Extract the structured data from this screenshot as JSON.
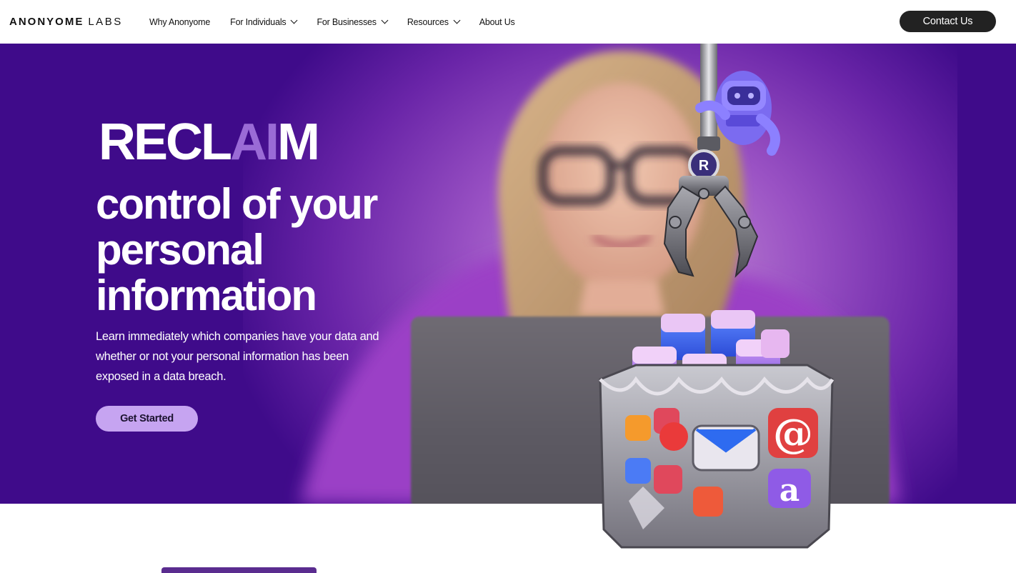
{
  "header": {
    "logo_bold": "ANONYOME",
    "logo_light": "LABS",
    "nav": [
      {
        "label": "Why Anonyome",
        "dropdown": false
      },
      {
        "label": "For Individuals",
        "dropdown": true
      },
      {
        "label": "For Businesses",
        "dropdown": true
      },
      {
        "label": "Resources",
        "dropdown": true
      },
      {
        "label": "About Us",
        "dropdown": false
      }
    ],
    "contact_label": "Contact Us"
  },
  "hero": {
    "word_pre": "RECL",
    "word_ai": "AI",
    "word_post": "M",
    "headline": "control of your personal information",
    "subtext": "Learn immediately which companies have your data and whether or not your personal information has been exposed in a data breach.",
    "cta_label": "Get Started",
    "robot_badge": "R",
    "colors": {
      "hero_bg": "#3f0b8a",
      "accent": "#9a6bd6",
      "cta": "#c6a4f1"
    }
  }
}
